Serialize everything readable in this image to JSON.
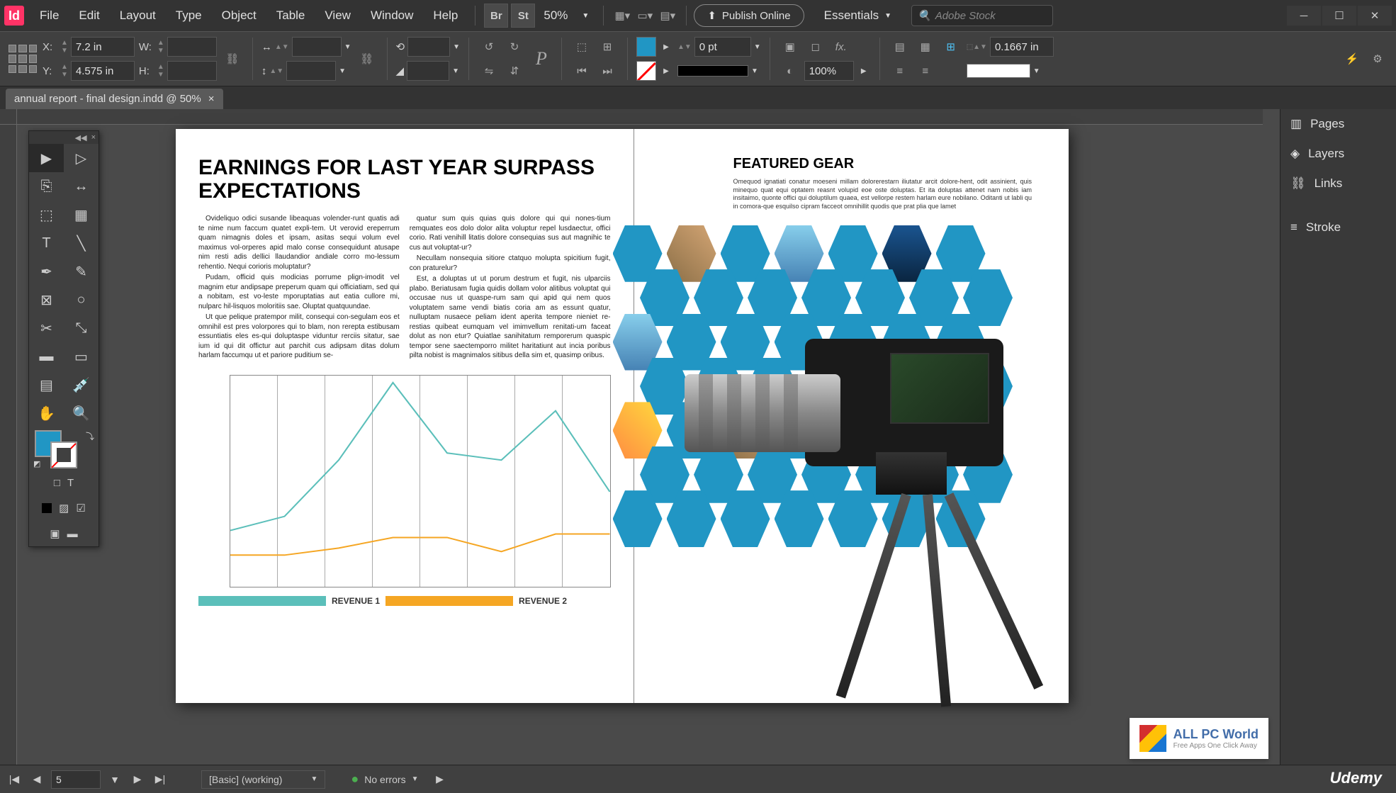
{
  "app": {
    "icon": "Id"
  },
  "menu": [
    "File",
    "Edit",
    "Layout",
    "Type",
    "Object",
    "Table",
    "View",
    "Window",
    "Help"
  ],
  "menu_extras": {
    "br": "Br",
    "st": "St",
    "zoom": "50%"
  },
  "publish": "Publish Online",
  "workspace": "Essentials",
  "search_placeholder": "Adobe Stock",
  "control": {
    "x_label": "X:",
    "x_val": "7.2 in",
    "y_label": "Y:",
    "y_val": "4.575 in",
    "w_label": "W:",
    "h_label": "H:",
    "stroke_pt": "0 pt",
    "opacity": "100%",
    "corner": "0.1667 in"
  },
  "tab": {
    "title": "annual report - final design.indd @ 50%"
  },
  "panels": [
    "Pages",
    "Layers",
    "Links",
    "Stroke"
  ],
  "status": {
    "page": "5",
    "preflight": "[Basic] (working)",
    "errors": "No errors"
  },
  "document": {
    "left": {
      "headline": "EARNINGS FOR LAST YEAR SURPASS EXPECTATIONS",
      "col1_p1": "Ovideliquo odici susande libeaquas volender-runt quatis adi te nime num faccum quatet expli-tem. Ut verovid ereperrum quam nimagnis doles et ipsam, asitas sequi volum evel maximus vol-orperes apid malo conse consequidunt atusape nim resti adis dellici llaudandior andiale corro mo-lessum rehentio. Nequi corioris moluptatur?",
      "col1_p2": "Pudam, officid quis modicias porrume plign-imodit vel magnim etur andipsape preperum quam qui officiatiam, sed qui a nobitam, est vo-leste mporuptatias aut eatia cullore mi, nulparc hil-lisquos moloritiis sae. Oluptat quatquundae.",
      "col1_p3": "Ut que pelique pratempor milit, consequi con-segulam eos et omnihil est pres volorpores qui to blam, non rerepta estibusam essuntiatis eles es-qui doluptaspe viduntur rerciis sitatur, sae ium id qui dit offictur aut parchit cus adipsam ditas dolum harlam faccumqu ut et pariore puditium se-",
      "col2_p1": "quatur sum quis quias quis dolore qui qui nones-tium remquates eos dolo dolor alita voluptur repel lusdaectur, offici corio. Rati venihill litatis dolore consequias sus aut magnihic te cus aut voluptat-ur?",
      "col2_p2": "Necullam nonsequia sitiore ctatquo molupta spicitium fugit, con praturelur?",
      "col2_p3": "Est, a doluptas ut ut porum destrum et fugit, nis ulparciis plabo. Beriatusam fugia quidis dollam volor alitibus voluptat qui occusae nus ut quaspe-rum sam qui apid qui nem quos voluptatem same vendi biatis coria am as essunt quatur, nulluptam nusaece peliam ident aperita tempore nieniet re-restias quibeat eumquam vel imimvellum renitati-um faceat dolut as non etur? Quiatlae sanihitatum remporerum quaspic tempor sene saectemporro militet haritatiunt aut incia poribus pilta nobist is magnimalos sitibus della sim et, quasimp oribus.",
      "legend1": "REVENUE 1",
      "legend2": "REVENUE 2"
    },
    "right": {
      "title": "FEATURED GEAR",
      "body": "Omequod ignatiati conatur moeseni millam dolorerestarn iliutatur arcit dolore-hent, odit assinient, quis minequo quat equi optatem reasnt volupid eoe oste doluptas. Et ita doluptas attenet nam nobis iam insitaimo, quonte offici qui doluptilum quaea, est vellorpe restem harlam eure nobilano. Oditanti ut labli qu in comora-que esquilso cipram facceot omnihillit quodis que prat plia que lamet"
    }
  },
  "chart_data": {
    "type": "line",
    "x": [
      0,
      1,
      2,
      3,
      4,
      5,
      6,
      7
    ],
    "series": [
      {
        "name": "REVENUE 1",
        "color": "#5BBFBA",
        "values": [
          220,
          200,
          120,
          10,
          110,
          120,
          50,
          165
        ]
      },
      {
        "name": "REVENUE 2",
        "color": "#F5A623",
        "values": [
          255,
          255,
          245,
          230,
          230,
          250,
          225,
          225
        ]
      }
    ],
    "ylim": [
      0,
      300
    ],
    "xlabel": "",
    "ylabel": "",
    "title": ""
  },
  "watermark": {
    "title": "ALL PC World",
    "sub": "Free Apps One Click Away",
    "udemy": "Udemy"
  }
}
